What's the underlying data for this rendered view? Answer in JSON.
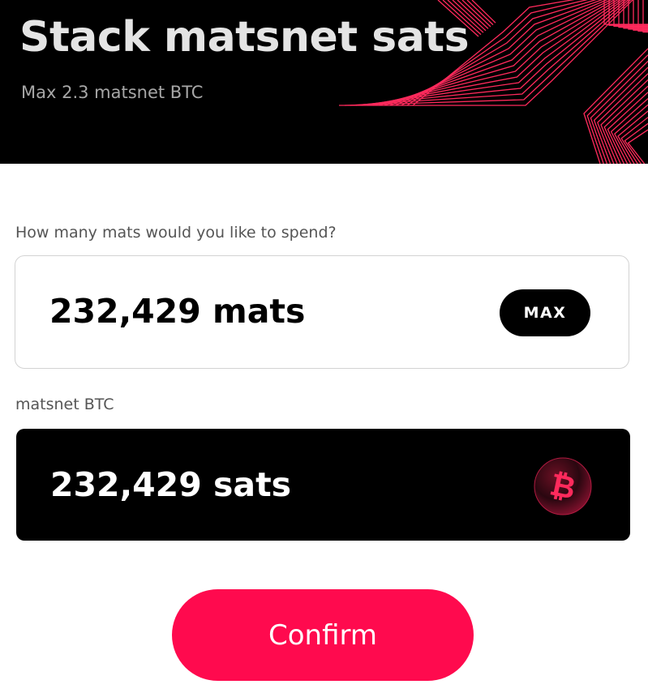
{
  "header": {
    "title": "Stack matsnet sats",
    "subtitle": "Max 2.3 matsnet BTC"
  },
  "spend": {
    "label": "How many mats would you like to spend?",
    "amount": "232,429 mats",
    "max_label": "MAX"
  },
  "receive": {
    "label": "matsnet BTC",
    "amount": "232,429 sats",
    "icon": "bitcoin-icon"
  },
  "actions": {
    "confirm_label": "Confirm"
  },
  "colors": {
    "accent": "#ff0a4e",
    "header_bg": "#000000",
    "stripe": "#ff2a5c"
  }
}
